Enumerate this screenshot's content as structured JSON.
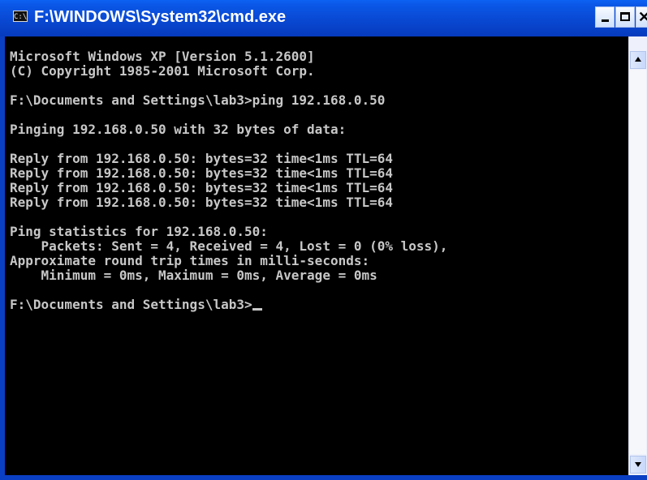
{
  "window": {
    "title": "F:\\WINDOWS\\System32\\cmd.exe",
    "icon_label": "C:\\",
    "controls": {
      "minimize": "minimize",
      "maximize": "maximize",
      "close": "close"
    }
  },
  "console": {
    "lines": [
      "Microsoft Windows XP [Version 5.1.2600]",
      "(C) Copyright 1985-2001 Microsoft Corp.",
      "",
      "F:\\Documents and Settings\\lab3>ping 192.168.0.50",
      "",
      "Pinging 192.168.0.50 with 32 bytes of data:",
      "",
      "Reply from 192.168.0.50: bytes=32 time<1ms TTL=64",
      "Reply from 192.168.0.50: bytes=32 time<1ms TTL=64",
      "Reply from 192.168.0.50: bytes=32 time<1ms TTL=64",
      "Reply from 192.168.0.50: bytes=32 time<1ms TTL=64",
      "",
      "Ping statistics for 192.168.0.50:",
      "    Packets: Sent = 4, Received = 4, Lost = 0 (0% loss),",
      "Approximate round trip times in milli-seconds:",
      "    Minimum = 0ms, Maximum = 0ms, Average = 0ms",
      "",
      "F:\\Documents and Settings\\lab3>"
    ]
  },
  "colors": {
    "title_bar": "#0948d2",
    "console_background": "#000000",
    "console_text": "#c7c7c7"
  },
  "icons": {
    "window": "cmd-window-icon",
    "scroll_up": "arrow-up-icon",
    "scroll_down": "arrow-down-icon"
  }
}
